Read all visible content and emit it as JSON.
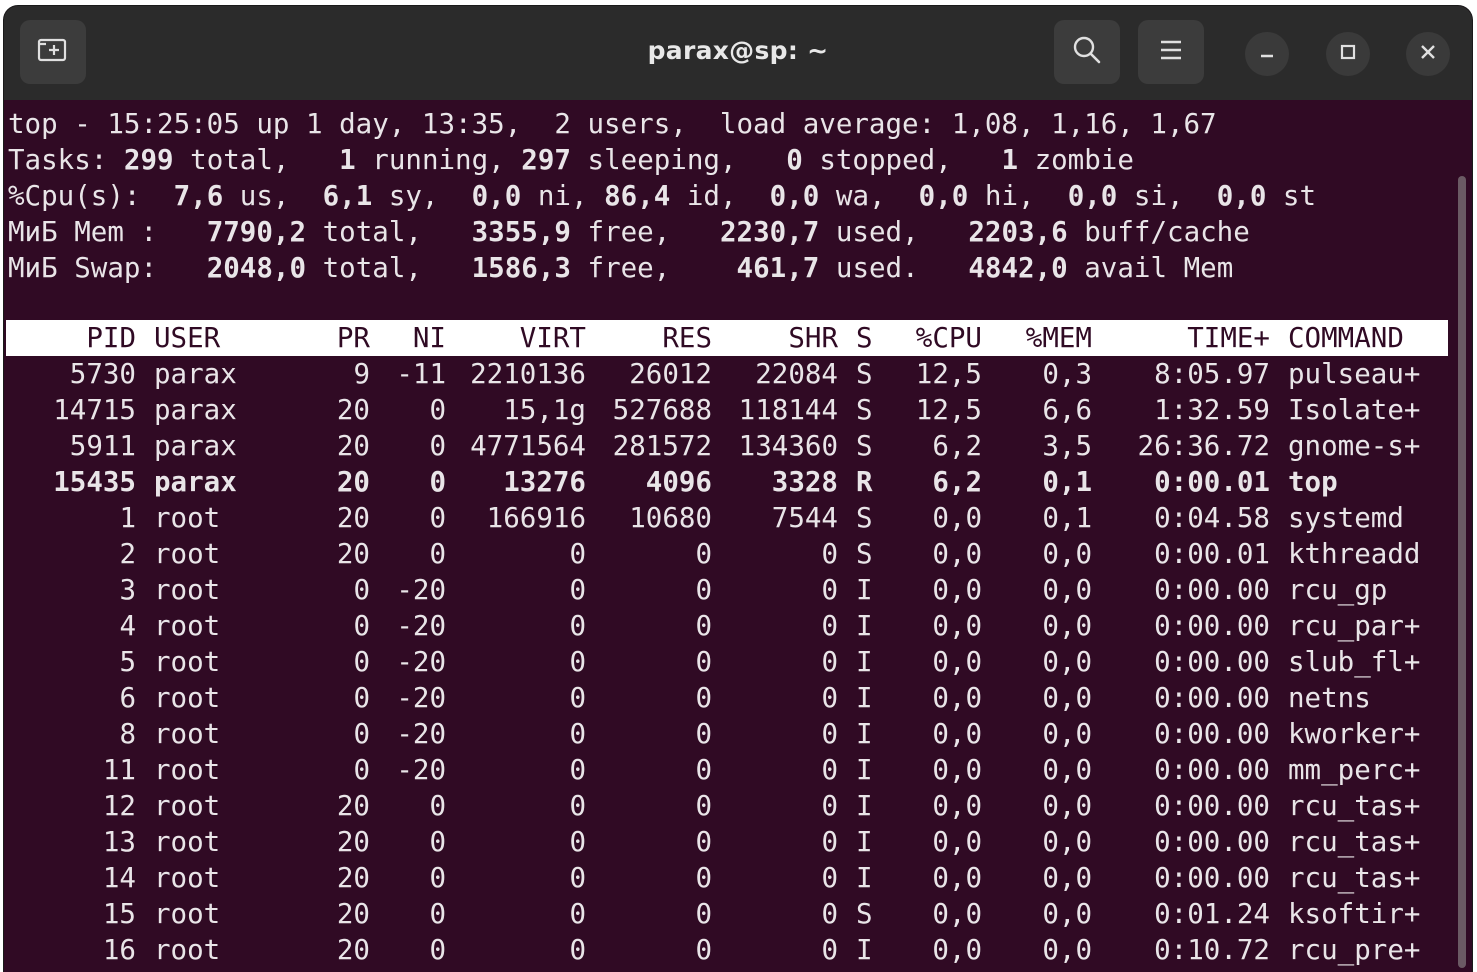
{
  "window": {
    "title": "parax@sp: ~"
  },
  "summary": {
    "line1": "top - 15:25:05 up 1 day, 13:35,  2 users,  load average: 1,08, 1,16, 1,67",
    "line2": [
      {
        "t": "Tasks: ",
        "b": false
      },
      {
        "t": "299",
        "b": true
      },
      {
        "t": " total,   ",
        "b": false
      },
      {
        "t": "1",
        "b": true
      },
      {
        "t": " running, ",
        "b": false
      },
      {
        "t": "297",
        "b": true
      },
      {
        "t": " sleeping,   ",
        "b": false
      },
      {
        "t": "0",
        "b": true
      },
      {
        "t": " stopped,   ",
        "b": false
      },
      {
        "t": "1",
        "b": true
      },
      {
        "t": " zombie",
        "b": false
      }
    ],
    "line3": [
      {
        "t": "%Cpu(s):  ",
        "b": false
      },
      {
        "t": "7,6",
        "b": true
      },
      {
        "t": " us,  ",
        "b": false
      },
      {
        "t": "6,1",
        "b": true
      },
      {
        "t": " sy,  ",
        "b": false
      },
      {
        "t": "0,0",
        "b": true
      },
      {
        "t": " ni, ",
        "b": false
      },
      {
        "t": "86,4",
        "b": true
      },
      {
        "t": " id,  ",
        "b": false
      },
      {
        "t": "0,0",
        "b": true
      },
      {
        "t": " wa,  ",
        "b": false
      },
      {
        "t": "0,0",
        "b": true
      },
      {
        "t": " hi,  ",
        "b": false
      },
      {
        "t": "0,0",
        "b": true
      },
      {
        "t": " si,  ",
        "b": false
      },
      {
        "t": "0,0",
        "b": true
      },
      {
        "t": " st",
        "b": false
      }
    ],
    "line4": [
      {
        "t": "МиБ Mem :   ",
        "b": false
      },
      {
        "t": "7790,2",
        "b": true
      },
      {
        "t": " total,   ",
        "b": false
      },
      {
        "t": "3355,9",
        "b": true
      },
      {
        "t": " free,   ",
        "b": false
      },
      {
        "t": "2230,7",
        "b": true
      },
      {
        "t": " used,   ",
        "b": false
      },
      {
        "t": "2203,6",
        "b": true
      },
      {
        "t": " buff/cache",
        "b": false
      }
    ],
    "line5": [
      {
        "t": "МиБ Swap:   ",
        "b": false
      },
      {
        "t": "2048,0",
        "b": true
      },
      {
        "t": " total,   ",
        "b": false
      },
      {
        "t": "1586,3",
        "b": true
      },
      {
        "t": " free,    ",
        "b": false
      },
      {
        "t": "461,7",
        "b": true
      },
      {
        "t": " used.   ",
        "b": false
      },
      {
        "t": "4842,0",
        "b": true
      },
      {
        "t": " avail Mem",
        "b": false
      }
    ]
  },
  "table": {
    "columns": [
      "PID",
      "USER",
      "PR",
      "NI",
      "VIRT",
      "RES",
      "SHR",
      "S",
      "%CPU",
      "%MEM",
      "TIME+",
      "COMMAND"
    ],
    "rows": [
      {
        "pid": "5730",
        "user": "parax",
        "pr": "9",
        "ni": "-11",
        "virt": "2210136",
        "res": "26012",
        "shr": "22084",
        "s": "S",
        "cpu": "12,5",
        "mem": "0,3",
        "time": "8:05.97",
        "cmd": "pulseau+",
        "bold": false
      },
      {
        "pid": "14715",
        "user": "parax",
        "pr": "20",
        "ni": "0",
        "virt": "15,1g",
        "res": "527688",
        "shr": "118144",
        "s": "S",
        "cpu": "12,5",
        "mem": "6,6",
        "time": "1:32.59",
        "cmd": "Isolate+",
        "bold": false
      },
      {
        "pid": "5911",
        "user": "parax",
        "pr": "20",
        "ni": "0",
        "virt": "4771564",
        "res": "281572",
        "shr": "134360",
        "s": "S",
        "cpu": "6,2",
        "mem": "3,5",
        "time": "26:36.72",
        "cmd": "gnome-s+",
        "bold": false
      },
      {
        "pid": "15435",
        "user": "parax",
        "pr": "20",
        "ni": "0",
        "virt": "13276",
        "res": "4096",
        "shr": "3328",
        "s": "R",
        "cpu": "6,2",
        "mem": "0,1",
        "time": "0:00.01",
        "cmd": "top",
        "bold": true
      },
      {
        "pid": "1",
        "user": "root",
        "pr": "20",
        "ni": "0",
        "virt": "166916",
        "res": "10680",
        "shr": "7544",
        "s": "S",
        "cpu": "0,0",
        "mem": "0,1",
        "time": "0:04.58",
        "cmd": "systemd",
        "bold": false
      },
      {
        "pid": "2",
        "user": "root",
        "pr": "20",
        "ni": "0",
        "virt": "0",
        "res": "0",
        "shr": "0",
        "s": "S",
        "cpu": "0,0",
        "mem": "0,0",
        "time": "0:00.01",
        "cmd": "kthreadd",
        "bold": false
      },
      {
        "pid": "3",
        "user": "root",
        "pr": "0",
        "ni": "-20",
        "virt": "0",
        "res": "0",
        "shr": "0",
        "s": "I",
        "cpu": "0,0",
        "mem": "0,0",
        "time": "0:00.00",
        "cmd": "rcu_gp",
        "bold": false
      },
      {
        "pid": "4",
        "user": "root",
        "pr": "0",
        "ni": "-20",
        "virt": "0",
        "res": "0",
        "shr": "0",
        "s": "I",
        "cpu": "0,0",
        "mem": "0,0",
        "time": "0:00.00",
        "cmd": "rcu_par+",
        "bold": false
      },
      {
        "pid": "5",
        "user": "root",
        "pr": "0",
        "ni": "-20",
        "virt": "0",
        "res": "0",
        "shr": "0",
        "s": "I",
        "cpu": "0,0",
        "mem": "0,0",
        "time": "0:00.00",
        "cmd": "slub_fl+",
        "bold": false
      },
      {
        "pid": "6",
        "user": "root",
        "pr": "0",
        "ni": "-20",
        "virt": "0",
        "res": "0",
        "shr": "0",
        "s": "I",
        "cpu": "0,0",
        "mem": "0,0",
        "time": "0:00.00",
        "cmd": "netns",
        "bold": false
      },
      {
        "pid": "8",
        "user": "root",
        "pr": "0",
        "ni": "-20",
        "virt": "0",
        "res": "0",
        "shr": "0",
        "s": "I",
        "cpu": "0,0",
        "mem": "0,0",
        "time": "0:00.00",
        "cmd": "kworker+",
        "bold": false
      },
      {
        "pid": "11",
        "user": "root",
        "pr": "0",
        "ni": "-20",
        "virt": "0",
        "res": "0",
        "shr": "0",
        "s": "I",
        "cpu": "0,0",
        "mem": "0,0",
        "time": "0:00.00",
        "cmd": "mm_perc+",
        "bold": false
      },
      {
        "pid": "12",
        "user": "root",
        "pr": "20",
        "ni": "0",
        "virt": "0",
        "res": "0",
        "shr": "0",
        "s": "I",
        "cpu": "0,0",
        "mem": "0,0",
        "time": "0:00.00",
        "cmd": "rcu_tas+",
        "bold": false
      },
      {
        "pid": "13",
        "user": "root",
        "pr": "20",
        "ni": "0",
        "virt": "0",
        "res": "0",
        "shr": "0",
        "s": "I",
        "cpu": "0,0",
        "mem": "0,0",
        "time": "0:00.00",
        "cmd": "rcu_tas+",
        "bold": false
      },
      {
        "pid": "14",
        "user": "root",
        "pr": "20",
        "ni": "0",
        "virt": "0",
        "res": "0",
        "shr": "0",
        "s": "I",
        "cpu": "0,0",
        "mem": "0,0",
        "time": "0:00.00",
        "cmd": "rcu_tas+",
        "bold": false
      },
      {
        "pid": "15",
        "user": "root",
        "pr": "20",
        "ni": "0",
        "virt": "0",
        "res": "0",
        "shr": "0",
        "s": "S",
        "cpu": "0,0",
        "mem": "0,0",
        "time": "0:01.24",
        "cmd": "ksoftir+",
        "bold": false
      },
      {
        "pid": "16",
        "user": "root",
        "pr": "20",
        "ni": "0",
        "virt": "0",
        "res": "0",
        "shr": "0",
        "s": "I",
        "cpu": "0,0",
        "mem": "0,0",
        "time": "0:10.72",
        "cmd": "rcu_pre+",
        "bold": false
      }
    ]
  },
  "colors": {
    "terminal_bg": "#300a24",
    "terminal_fg": "#e9e5e8",
    "titlebar_bg": "#2b2b2b",
    "header_bg": "#ffffff"
  },
  "icons": {
    "new_tab": "new-tab-icon",
    "search": "search-icon",
    "menu": "hamburger-menu-icon",
    "minimize": "minimize-icon",
    "maximize": "maximize-icon",
    "close": "close-icon"
  }
}
